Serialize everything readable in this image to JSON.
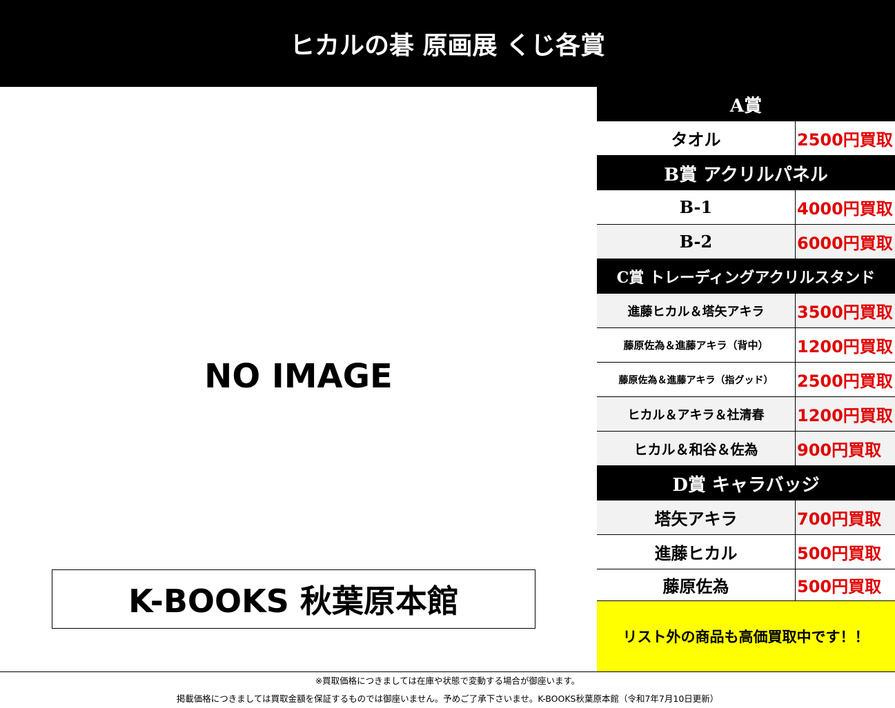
{
  "header": {
    "title": "ヒカルの碁 原画展 くじ各賞"
  },
  "image_area": {
    "placeholder": "NO IMAGE",
    "store": "K-BOOKS 秋葉原本館"
  },
  "prizes": {
    "a": {
      "title": "A賞",
      "items": [
        {
          "name": "タオル",
          "price": "2500円買取"
        }
      ]
    },
    "b": {
      "title": "B賞 アクリルパネル",
      "items": [
        {
          "name": "B-1",
          "price": "4000円買取"
        },
        {
          "name": "B-2",
          "price": "6000円買取"
        }
      ]
    },
    "c": {
      "title": "C賞 トレーディングアクリルスタンド",
      "items": [
        {
          "name": "進藤ヒカル＆塔矢アキラ",
          "price": "3500円買取"
        },
        {
          "name": "藤原佐為＆進藤アキラ（背中）",
          "price": "1200円買取"
        },
        {
          "name": "藤原佐為＆進藤アキラ（指グッド）",
          "price": "2500円買取"
        },
        {
          "name": "ヒカル＆アキラ＆社清春",
          "price": "1200円買取"
        },
        {
          "name": "ヒカル＆和谷＆佐為",
          "price": "900円買取"
        }
      ]
    },
    "d": {
      "title": "D賞 キャラバッジ",
      "items": [
        {
          "name": "塔矢アキラ",
          "price": "700円買取"
        },
        {
          "name": "進藤ヒカル",
          "price": "500円買取"
        },
        {
          "name": "藤原佐為",
          "price": "500円買取"
        }
      ]
    }
  },
  "notice": "リスト外の商品も高価買取中です！！",
  "footer": {
    "line1": "※買取価格につきましては在庫や状態で変動する場合が御座います。",
    "line2": "掲載価格につきましては買取金額を保証するものでは御座いません。予めご了承下さいませ。K-BOOKS秋葉原本館（令和7年7月10日更新）"
  }
}
